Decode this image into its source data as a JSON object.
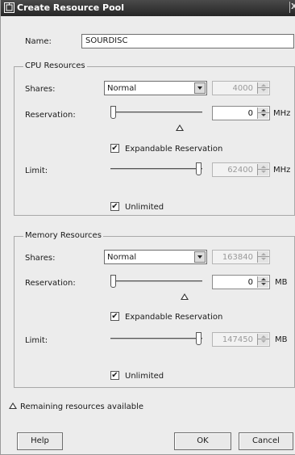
{
  "window": {
    "title": "Create Resource Pool",
    "close_glyph": "X"
  },
  "name": {
    "label": "Name:",
    "value": "SOURDISC"
  },
  "cpu": {
    "group_title": "CPU Resources",
    "shares_label": "Shares:",
    "shares_selected": "Normal",
    "shares_value": "4000",
    "reservation_label": "Reservation:",
    "reservation_value": "0",
    "reservation_unit": "MHz",
    "reservation_level": 0,
    "expandable_label": "Expandable Reservation",
    "expandable_checked": true,
    "limit_label": "Limit:",
    "limit_value": "62400",
    "limit_unit": "MHz",
    "limit_level": 1,
    "unlimited_label": "Unlimited",
    "unlimited_checked": true
  },
  "memory": {
    "group_title": "Memory Resources",
    "shares_label": "Shares:",
    "shares_selected": "Normal",
    "shares_value": "163840",
    "reservation_label": "Reservation:",
    "reservation_value": "0",
    "reservation_unit": "MB",
    "reservation_level": 0,
    "expandable_label": "Expandable Reservation",
    "expandable_checked": true,
    "limit_label": "Limit:",
    "limit_value": "147450",
    "limit_unit": "MB",
    "limit_level": 1,
    "unlimited_label": "Unlimited",
    "unlimited_checked": true
  },
  "legend": {
    "text": "Remaining resources available"
  },
  "buttons": {
    "help": "Help",
    "ok": "OK",
    "cancel": "Cancel"
  },
  "icons": {
    "title": "resource-pool-icon",
    "legend": "triangle-marker-icon",
    "checkmark": "✔"
  }
}
